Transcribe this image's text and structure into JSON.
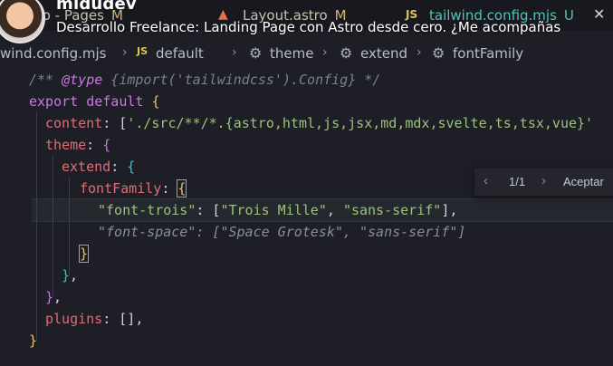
{
  "overlay": {
    "channel": "midudev",
    "video_title": "Desarrollo Freelance: Landing Page con Astro desde cero. ¿Me acompañas"
  },
  "tabs": [
    {
      "label": "astro - Pages",
      "mark": "M"
    },
    {
      "label": "Layout.astro",
      "mark": "M"
    },
    {
      "label": "tailwind.config.mjs",
      "mark": "U"
    }
  ],
  "tab_icons": {
    "js": "JS"
  },
  "breadcrumb": {
    "file": "wind.config.mjs",
    "items": [
      "default",
      "theme",
      "extend",
      "fontFamily"
    ]
  },
  "widget": {
    "count": "1/1",
    "accept": "Aceptar"
  },
  "code": {
    "line1_comment_start": "/** ",
    "line1_type": "@type",
    "line1_rest": " {import('tailwindcss').Config} */",
    "export": "export",
    "default": "default",
    "content_key": "content",
    "content_value": "'./src/**/*.{astro,html,js,jsx,md,mdx,svelte,ts,tsx,vue}'",
    "theme_key": "theme",
    "extend_key": "extend",
    "fontFamily_key": "fontFamily",
    "font_trois_key": "\"font-trois\"",
    "font_trois_v1": "\"Trois Mille\"",
    "font_trois_v2": "\"sans-serif\"",
    "font_space_ghost": "\"font-space\": [\"Space Grotesk\", \"sans-serif\"]",
    "plugins_key": "plugins",
    "plugins_value": "[],"
  },
  "colors": {
    "keyword": "#c778dd",
    "property": "#e06c75",
    "string": "#98c379",
    "accent_tab": "#4bc6b5"
  }
}
